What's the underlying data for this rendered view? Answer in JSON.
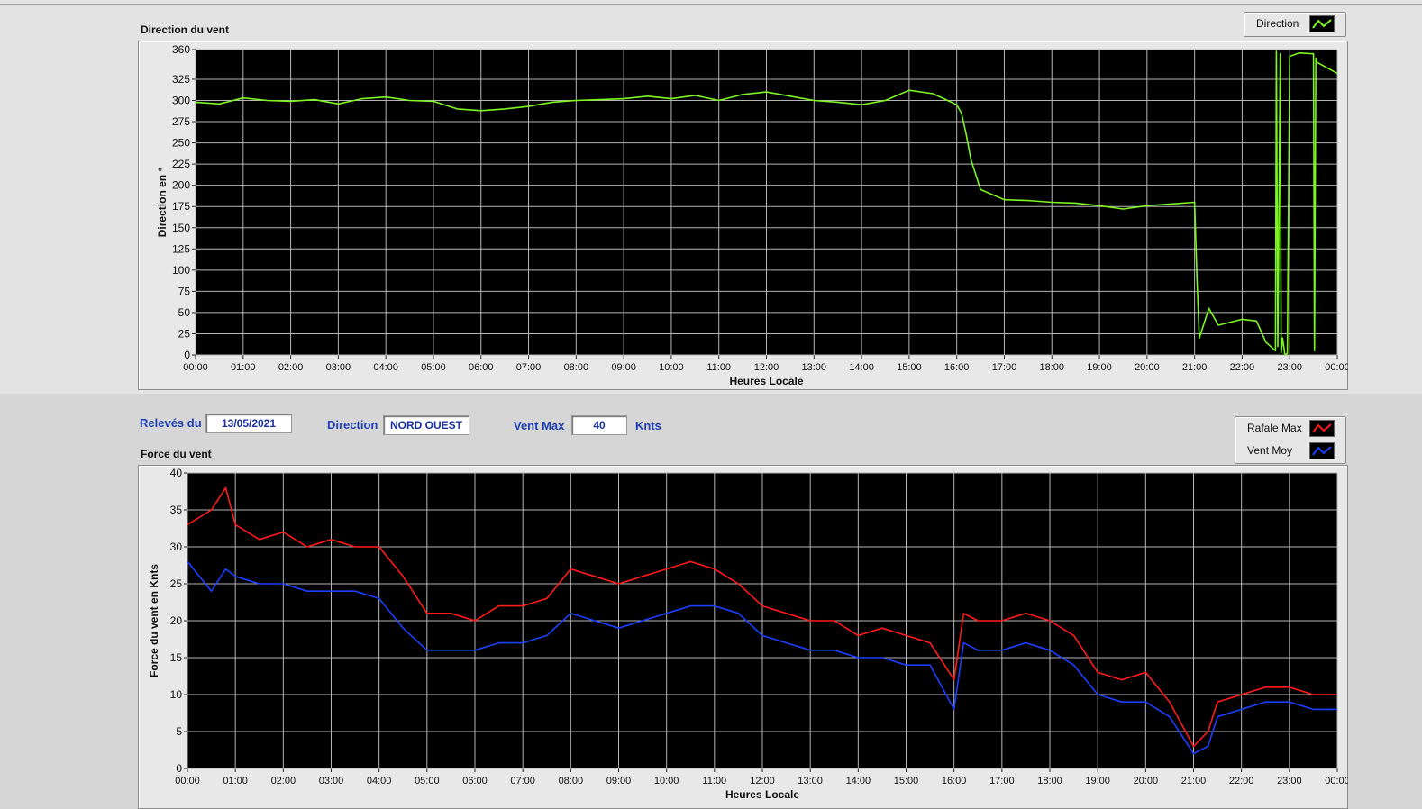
{
  "direction_chart": {
    "title": "Direction du vent",
    "legend": [
      {
        "name": "Direction",
        "color": "#7cf521"
      }
    ]
  },
  "info": {
    "releves_label": "Relevés du",
    "date_value": "13/05/2021",
    "direction_label": "Direction",
    "direction_value": "NORD OUEST",
    "vent_max_label": "Vent Max",
    "vent_max_value": "40",
    "unit_label": "Knts"
  },
  "force_chart": {
    "title": "Force du vent",
    "legend": [
      {
        "name": "Rafale Max",
        "color": "#ff1a1a"
      },
      {
        "name": "Vent Moy",
        "color": "#1a3fff"
      }
    ]
  },
  "chart_data": [
    {
      "type": "line",
      "title": "Direction du vent",
      "xlabel": "Heures Locale",
      "ylabel": "Direction en °",
      "xlim": [
        0,
        24
      ],
      "ylim": [
        0,
        360
      ],
      "yticks": [
        0,
        25,
        50,
        75,
        100,
        125,
        150,
        175,
        200,
        225,
        250,
        275,
        300,
        325,
        360
      ],
      "xticks": [
        "00:00",
        "01:00",
        "02:00",
        "03:00",
        "04:00",
        "05:00",
        "06:00",
        "07:00",
        "08:00",
        "09:00",
        "10:00",
        "11:00",
        "12:00",
        "13:00",
        "14:00",
        "15:00",
        "16:00",
        "17:00",
        "18:00",
        "19:00",
        "20:00",
        "21:00",
        "22:00",
        "23:00",
        "00:00"
      ],
      "grid": true,
      "legend_position": "top-right",
      "series": [
        {
          "name": "Direction",
          "color": "#7cf521",
          "x": [
            0,
            0.5,
            1,
            1.5,
            2,
            2.5,
            3,
            3.5,
            4,
            4.5,
            5,
            5.5,
            6,
            6.5,
            7,
            7.5,
            8,
            8.5,
            9,
            9.5,
            10,
            10.5,
            11,
            11.5,
            12,
            12.5,
            13,
            13.5,
            14,
            14.5,
            15,
            15.5,
            16,
            16.1,
            16.2,
            16.3,
            16.5,
            17,
            17.5,
            18,
            18.5,
            19,
            19.5,
            20,
            20.5,
            21,
            21.05,
            21.1,
            21.3,
            21.5,
            22,
            22.3,
            22.5,
            22.7,
            22.72,
            22.75,
            22.8,
            22.82,
            22.85,
            22.9,
            22.95,
            23,
            23.2,
            23.5,
            23.52,
            23.55,
            23.57,
            24
          ],
          "y": [
            298,
            296,
            303,
            300,
            299,
            301,
            296,
            302,
            304,
            300,
            299,
            290,
            288,
            290,
            293,
            298,
            300,
            301,
            302,
            305,
            302,
            306,
            300,
            307,
            310,
            305,
            300,
            298,
            295,
            300,
            312,
            308,
            295,
            285,
            260,
            230,
            195,
            183,
            182,
            180,
            179,
            176,
            172,
            176,
            178,
            180,
            90,
            20,
            55,
            35,
            42,
            40,
            15,
            5,
            358,
            10,
            355,
            2,
            20,
            0,
            2,
            352,
            356,
            355,
            5,
            350,
            345,
            332
          ]
        }
      ]
    },
    {
      "type": "line",
      "title": "Force du vent",
      "xlabel": "Heures Locale",
      "ylabel": "Force du vent en Knts",
      "xlim": [
        0,
        24
      ],
      "ylim": [
        0,
        40
      ],
      "yticks": [
        0,
        5,
        10,
        15,
        20,
        25,
        30,
        35,
        40
      ],
      "xticks": [
        "00:00",
        "01:00",
        "02:00",
        "03:00",
        "04:00",
        "05:00",
        "06:00",
        "07:00",
        "08:00",
        "09:00",
        "10:00",
        "11:00",
        "12:00",
        "13:00",
        "14:00",
        "15:00",
        "16:00",
        "17:00",
        "18:00",
        "19:00",
        "20:00",
        "21:00",
        "22:00",
        "23:00",
        "00:00"
      ],
      "grid": true,
      "legend_position": "top-right",
      "series": [
        {
          "name": "Rafale Max",
          "color": "#ff1a1a",
          "x": [
            0,
            0.5,
            0.8,
            1,
            1.5,
            2,
            2.5,
            3,
            3.5,
            4,
            4.5,
            5,
            5.5,
            6,
            6.5,
            7,
            7.5,
            8,
            8.5,
            9,
            9.5,
            10,
            10.5,
            11,
            11.5,
            12,
            12.5,
            13,
            13.5,
            14,
            14.5,
            15,
            15.5,
            16,
            16.2,
            16.5,
            17,
            17.5,
            18,
            18.5,
            19,
            19.5,
            20,
            20.5,
            21,
            21.3,
            21.5,
            22,
            22.5,
            23,
            23.5,
            24
          ],
          "y": [
            33,
            35,
            38,
            33,
            31,
            32,
            30,
            31,
            30,
            30,
            26,
            21,
            21,
            20,
            22,
            22,
            23,
            27,
            26,
            25,
            26,
            27,
            28,
            27,
            25,
            22,
            21,
            20,
            20,
            18,
            19,
            18,
            17,
            12,
            21,
            20,
            20,
            21,
            20,
            18,
            13,
            12,
            13,
            9,
            3,
            5,
            9,
            10,
            11,
            11,
            10,
            10
          ]
        },
        {
          "name": "Vent Moy",
          "color": "#1a3fff",
          "x": [
            0,
            0.5,
            0.8,
            1,
            1.5,
            2,
            2.5,
            3,
            3.5,
            4,
            4.5,
            5,
            5.5,
            6,
            6.5,
            7,
            7.5,
            8,
            8.5,
            9,
            9.5,
            10,
            10.5,
            11,
            11.5,
            12,
            12.5,
            13,
            13.5,
            14,
            14.5,
            15,
            15.5,
            16,
            16.2,
            16.5,
            17,
            17.5,
            18,
            18.5,
            19,
            19.5,
            20,
            20.5,
            21,
            21.3,
            21.5,
            22,
            22.5,
            23,
            23.5,
            24
          ],
          "y": [
            28,
            24,
            27,
            26,
            25,
            25,
            24,
            24,
            24,
            23,
            19,
            16,
            16,
            16,
            17,
            17,
            18,
            21,
            20,
            19,
            20,
            21,
            22,
            22,
            21,
            18,
            17,
            16,
            16,
            15,
            15,
            14,
            14,
            8,
            17,
            16,
            16,
            17,
            16,
            14,
            10,
            9,
            9,
            7,
            2,
            3,
            7,
            8,
            9,
            9,
            8,
            8
          ]
        }
      ]
    }
  ]
}
